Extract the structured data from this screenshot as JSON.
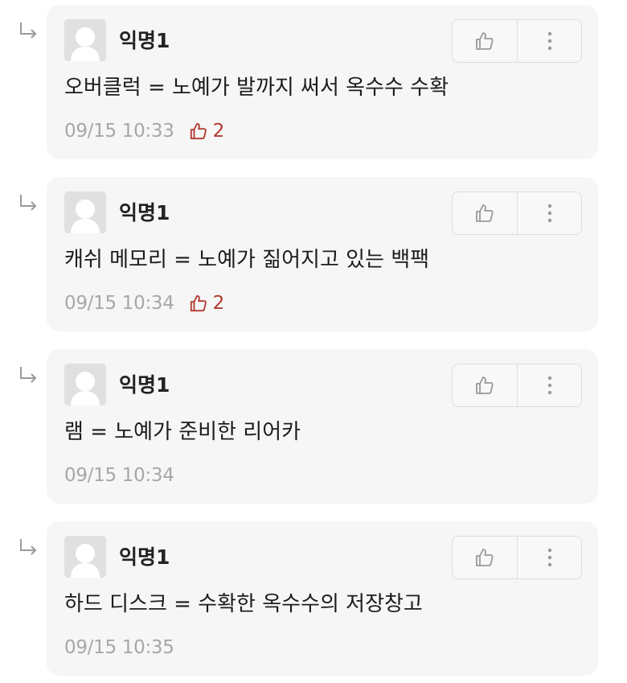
{
  "colors": {
    "card_background": "#f6f6f6",
    "vote_accent": "#b13a30",
    "timestamp": "#a7a7a7"
  },
  "comments": [
    {
      "author": "익명1",
      "text": "오버클럭 = 노예가 발까지 써서 옥수수 수확",
      "timestamp": "09/15 10:33",
      "votes": "2",
      "icons": [
        "reply-arrow-icon",
        "avatar-placeholder-icon",
        "thumbs-up-icon",
        "more-vertical-icon"
      ]
    },
    {
      "author": "익명1",
      "text": "캐쉬 메모리 = 노예가 짊어지고 있는 백팩",
      "timestamp": "09/15 10:34",
      "votes": "2",
      "icons": [
        "reply-arrow-icon",
        "avatar-placeholder-icon",
        "thumbs-up-icon",
        "more-vertical-icon"
      ]
    },
    {
      "author": "익명1",
      "text": "램 = 노예가 준비한 리어카",
      "timestamp": "09/15 10:34",
      "votes": null,
      "icons": [
        "reply-arrow-icon",
        "avatar-placeholder-icon",
        "thumbs-up-icon",
        "more-vertical-icon"
      ]
    },
    {
      "author": "익명1",
      "text": "하드 디스크 = 수확한 옥수수의 저장창고",
      "timestamp": "09/15 10:35",
      "votes": null,
      "icons": [
        "reply-arrow-icon",
        "avatar-placeholder-icon",
        "thumbs-up-icon",
        "more-vertical-icon"
      ]
    }
  ]
}
